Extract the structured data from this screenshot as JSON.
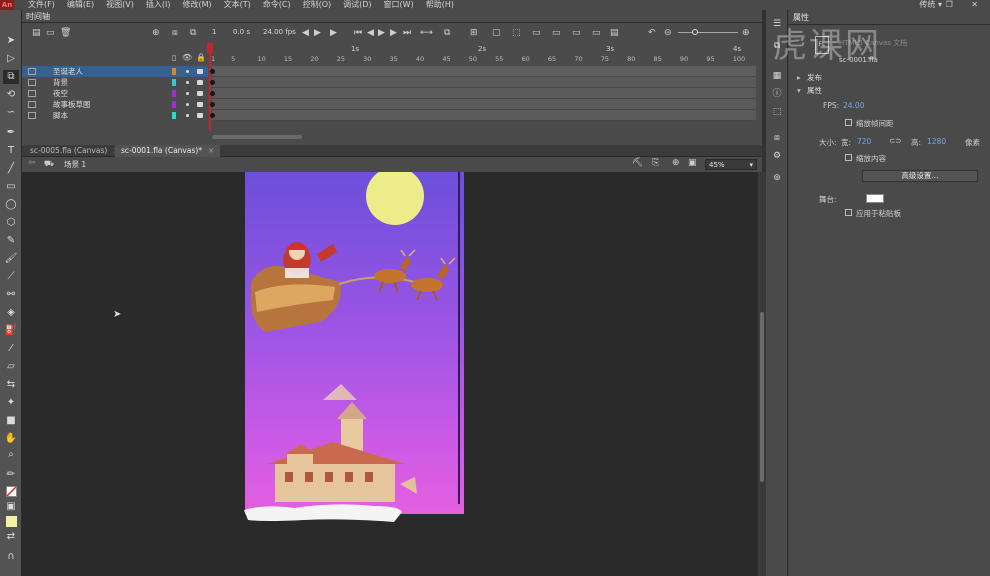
{
  "menu": {
    "logo": "An",
    "items": [
      "文件(F)",
      "编辑(E)",
      "视图(V)",
      "插入(I)",
      "修改(M)",
      "文本(T)",
      "命令(C)",
      "控制(O)",
      "调试(D)",
      "窗口(W)",
      "帮助(H)"
    ],
    "workspace": "传统 ▾",
    "window_controls": "— ❐ ✕"
  },
  "timeline": {
    "tab_label": "时间轴",
    "current_frame": "1",
    "time": "0.0 s",
    "fps": "24.00 fps",
    "ruler_seconds": [
      "1s",
      "2s",
      "3s",
      "4s"
    ],
    "ruler_frames": [
      "1",
      "5",
      "10",
      "15",
      "20",
      "25",
      "30",
      "35",
      "40",
      "45",
      "50",
      "55",
      "60",
      "65",
      "70",
      "75",
      "80",
      "85",
      "90",
      "95",
      "100"
    ],
    "layers": [
      {
        "name": "圣诞老人",
        "color": "#d9862f",
        "selected": true
      },
      {
        "name": "背景",
        "color": "#3ac6cf",
        "selected": false
      },
      {
        "name": "夜空",
        "color": "#9d2fcf",
        "selected": false
      },
      {
        "name": "故事板草图",
        "color": "#a12fd3",
        "selected": false
      },
      {
        "name": "脚本",
        "color": "#33d7cf",
        "selected": false
      }
    ]
  },
  "doc_tabs": [
    {
      "label": "sc-0005.fla (Canvas)",
      "close": "×"
    },
    {
      "label": "sc-0001.fla (Canvas)*",
      "close": "×"
    }
  ],
  "scene_bar": {
    "scene": "场景 1",
    "zoom": "45%"
  },
  "panel": {
    "tab": "属性",
    "doc_icon_label": "FL",
    "doc_type": "HTML5 Canvas 文档",
    "doc_name": "sc-0001.fla",
    "sections": {
      "publish": "发布",
      "properties": "属性"
    },
    "fps_label": "FPS:",
    "fps_value": "24.00",
    "scale_spans": "缩放帧间距",
    "size_label": "大小:",
    "width_label": "宽:",
    "width_value": "720",
    "height_label": "高:",
    "height_value": "1280",
    "unit": "像素",
    "scale_content": "缩放内容",
    "advanced_button": "高级设置...",
    "stage_label": "舞台:",
    "stage_color": "#ffffff",
    "apply_pasteboard": "应用于粘贴板"
  },
  "watermark": "虎课网",
  "stage_colors": {
    "top": "#6c4fdb",
    "bottom": "#e45fe0",
    "moon": "#ecec8a"
  }
}
